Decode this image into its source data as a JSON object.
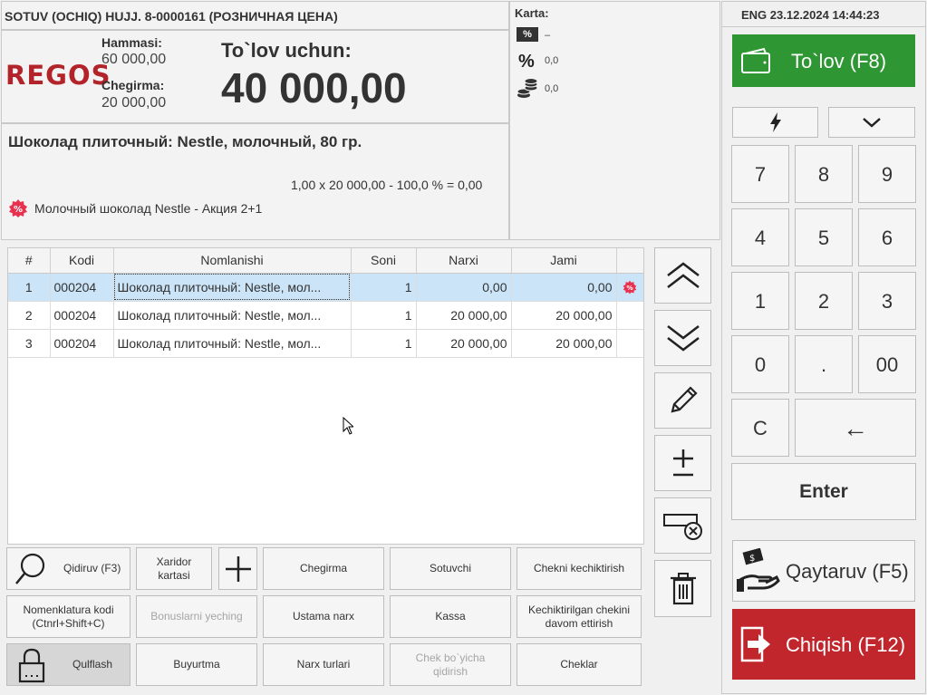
{
  "header": {
    "doc_title": "SOTUV (OCHIQ) HUJJ. 8-0000161  (РОЗНИЧНАЯ ЦЕНА)",
    "logo_text": "REGOS",
    "total_label": "Hammasi:",
    "total_value": "60 000,00",
    "discount_label": "Chegirma:",
    "discount_value": "20 000,00",
    "pay_label": "To`lov uchun:",
    "pay_value": "40 000,00"
  },
  "card": {
    "label": "Karta:",
    "rows": [
      {
        "icon": "percent-badge-icon",
        "value": "–"
      },
      {
        "icon": "percent-icon",
        "value": "0,0"
      },
      {
        "icon": "coins-icon",
        "value": "0,0"
      }
    ]
  },
  "product": {
    "name": "Шоколад плиточный: Nestle, молочный, 80 гр.",
    "formula": "1,00 x 20 000,00 - 100,0 % = 0,00",
    "promo": "Молочный шоколад Nestle - Акция 2+1"
  },
  "status": {
    "text": "ENG 23.12.2024 14:44:23"
  },
  "table": {
    "columns": [
      "#",
      "Kodi",
      "Nomlanishi",
      "Soni",
      "Narxi",
      "Jami"
    ],
    "rows": [
      {
        "n": "1",
        "code": "000204",
        "name": "Шоколад плиточный: Nestle, мол...",
        "qty": "1",
        "price": "0,00",
        "total": "0,00",
        "promo": true
      },
      {
        "n": "2",
        "code": "000204",
        "name": "Шоколад плиточный: Nestle, мол...",
        "qty": "1",
        "price": "20 000,00",
        "total": "20 000,00",
        "promo": false
      },
      {
        "n": "3",
        "code": "000204",
        "name": "Шоколад плиточный: Nestle, мол...",
        "qty": "1",
        "price": "20 000,00",
        "total": "20 000,00",
        "promo": false
      }
    ]
  },
  "bottom_buttons": {
    "search": "Qidiruv (F3)",
    "customer_card": "Xaridor\nkartasi",
    "discount": "Chegirma",
    "seller": "Sotuvchi",
    "delay_check": "Chekni kechiktirish",
    "nomenclature_code": "Nomenklatura kodi\n(Ctnrl+Shift+C)",
    "bonuses": "Bonuslarni yeching",
    "master_price": "Ustama narx",
    "cash": "Kassa",
    "continue_delayed": "Kechiktirilgan chekini\ndavom ettirish",
    "lock": "Qulflash",
    "order": "Buyurtma",
    "price_types": "Narx turlari",
    "search_by_check": "Chek bo`yicha\nqidirish",
    "checks": "Cheklar"
  },
  "right": {
    "pay_button": "To`lov (F8)",
    "keys": [
      "7",
      "8",
      "9",
      "4",
      "5",
      "6",
      "1",
      "2",
      "3",
      "0",
      ".",
      "00",
      "C",
      "←"
    ],
    "enter": "Enter",
    "return_button": "Qaytaruv (F5)",
    "exit_button": "Chiqish (F12)"
  },
  "colors": {
    "pay": "#2e9734",
    "exit": "#c0262c",
    "logo": "#b3232a",
    "selected_row": "#cce4f7"
  }
}
